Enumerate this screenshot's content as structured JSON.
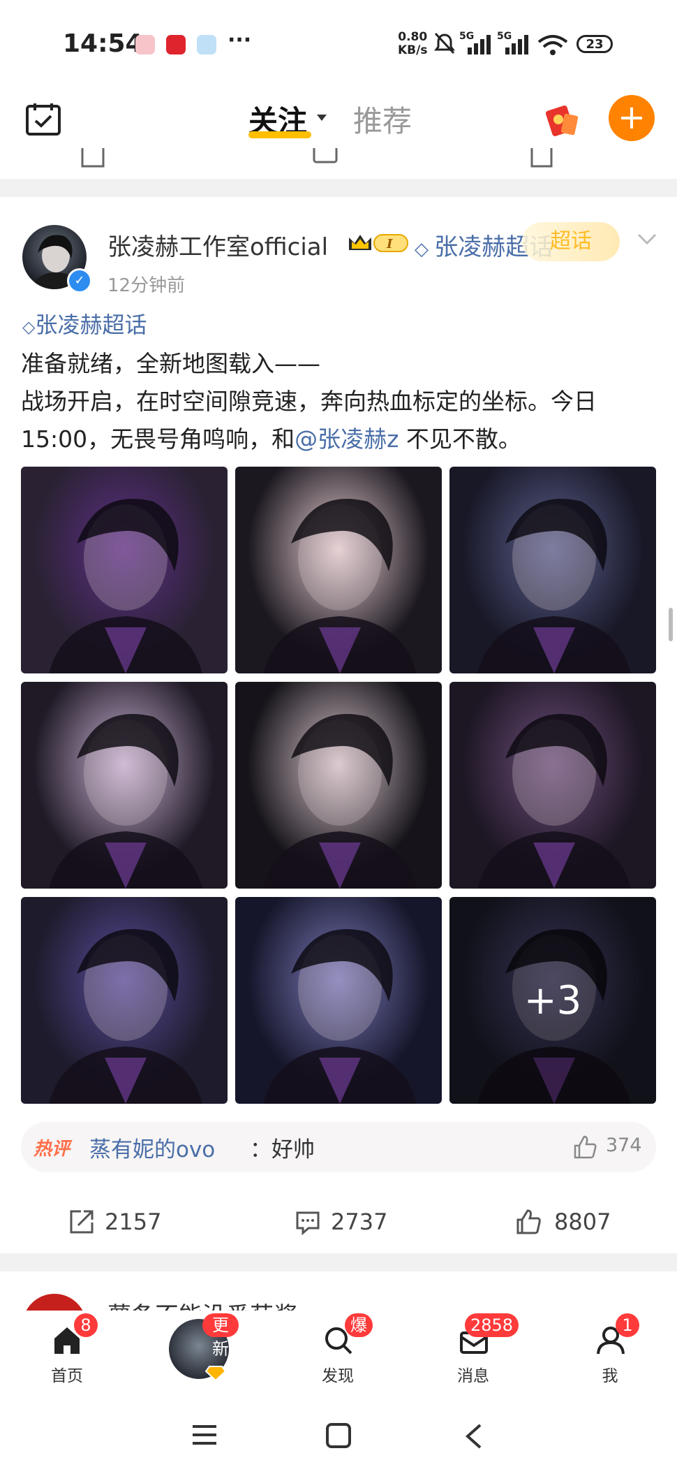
{
  "status_bar": {
    "time": "14:54",
    "net_speed_value": "0.80",
    "net_speed_unit": "KB/s",
    "signal1": "5G",
    "signal2": "5G",
    "battery": "23",
    "more": "···"
  },
  "header": {
    "tab_follow": "关注",
    "tab_recommend": "推荐",
    "plus": "+"
  },
  "post": {
    "username": "张凌赫工作室official",
    "crown_level": "I",
    "topic_tag": "张凌赫超话",
    "sticker": "超话",
    "time": "12分钟前",
    "topic": "张凌赫超话",
    "line1": "准备就绪，全新地图载入——",
    "line2": "战场开启，在时空间隙竞速，奔向热血标定的坐标。今日",
    "line3_pre": "15:00，无畏号角鸣响，和",
    "mention": "@张凌赫z",
    "line3_post": " 不见不散。",
    "more_images": "+3",
    "images": [
      {
        "c1": "#2a2233",
        "c2": "#5d2f86"
      },
      {
        "c1": "#1c1820",
        "c2": "#e6cfd2"
      },
      {
        "c1": "#181827",
        "c2": "#5b5f8c"
      },
      {
        "c1": "#201a26",
        "c2": "#c9b3d4"
      },
      {
        "c1": "#16141a",
        "c2": "#d8c6cc"
      },
      {
        "c1": "#1d1623",
        "c2": "#6c4f7c"
      },
      {
        "c1": "#1d1b2c",
        "c2": "#5a4c9a"
      },
      {
        "c1": "#15162a",
        "c2": "#7a78b8"
      },
      {
        "c1": "#1b1b28",
        "c2": "#514e80"
      }
    ]
  },
  "hot_comment": {
    "label": "热评",
    "user": "蒸有妮的ovo",
    "text": "：好帅",
    "likes": "374"
  },
  "actions": {
    "reposts": "2157",
    "comments": "2737",
    "likes": "8807"
  },
  "next_post": {
    "username": "薯条不能没番茄酱"
  },
  "tabbar": {
    "home_label": "首页",
    "home_badge": "8",
    "update_badge": "更新",
    "discover_label": "发现",
    "discover_badge": "爆",
    "messages_label": "消息",
    "messages_badge": "2858",
    "me_label": "我",
    "me_badge": "1"
  },
  "colors": {
    "accent": "#ff8200",
    "link": "#4a6ea8",
    "badge": "#ff3a3a",
    "underline": "#ffbe00"
  }
}
